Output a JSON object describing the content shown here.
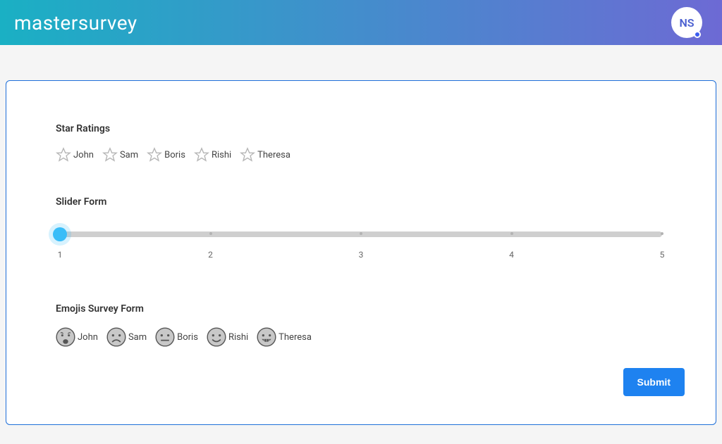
{
  "header": {
    "logo": "mastersurvey",
    "avatar_initials": "NS"
  },
  "sections": {
    "star": {
      "title": "Star Ratings",
      "options": [
        "John",
        "Sam",
        "Boris",
        "Rishi",
        "Theresa"
      ]
    },
    "slider": {
      "title": "Slider Form",
      "min": 1,
      "max": 5,
      "value": 1,
      "ticks": [
        "1",
        "2",
        "3",
        "4",
        "5"
      ]
    },
    "emoji": {
      "title": "Emojis Survey Form",
      "options": [
        "John",
        "Sam",
        "Boris",
        "Rishi",
        "Theresa"
      ]
    }
  },
  "actions": {
    "submit": "Submit"
  }
}
